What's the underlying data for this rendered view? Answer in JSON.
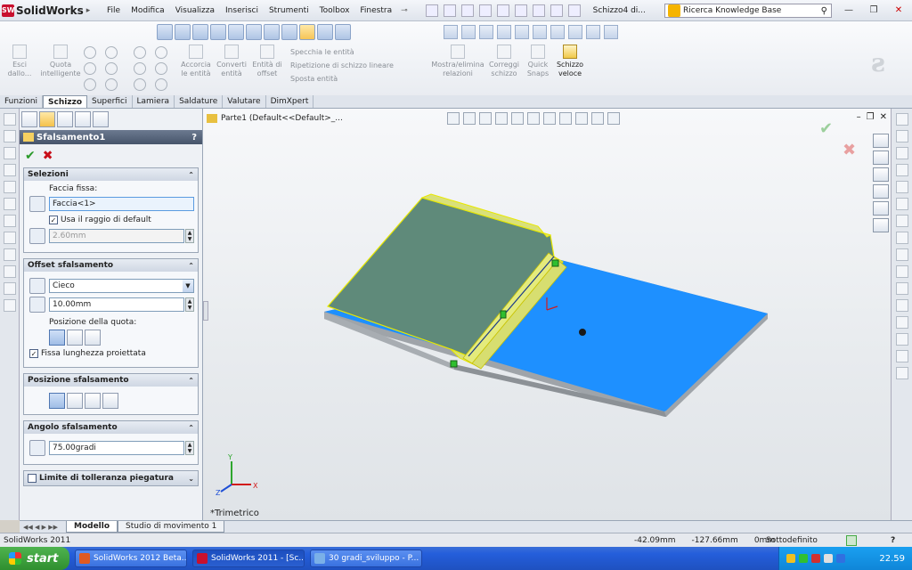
{
  "app": {
    "logo_text": "SolidWorks",
    "menu": [
      "File",
      "Modifica",
      "Visualizza",
      "Inserisci",
      "Strumenti",
      "Toolbox",
      "Finestra"
    ],
    "doc_title": "Schizzo4 di...",
    "search_placeholder": "Ricerca Knowledge Base"
  },
  "ribbon": {
    "groups": [
      {
        "label": "Esci\ndallo...",
        "active": false
      },
      {
        "label": "Quota\nintelligente",
        "active": false
      },
      {
        "label": "Accorcia\nle entità",
        "active": false
      },
      {
        "label": "Converti\nentità",
        "active": false
      },
      {
        "label": "Entità di\noffset",
        "active": false
      },
      {
        "label": "Mostra/elimina\nrelazioni",
        "active": false
      },
      {
        "label": "Correggi\nschizzo",
        "active": false
      },
      {
        "label": "Quick\nSnaps",
        "active": false
      },
      {
        "label": "Schizzo\nveloce",
        "active": true
      }
    ],
    "list_items": [
      "Specchia le entità",
      "Ripetizione di schizzo lineare",
      "Sposta entità"
    ]
  },
  "tabs": [
    {
      "label": "Funzioni",
      "active": false
    },
    {
      "label": "Schizzo",
      "active": true
    },
    {
      "label": "Superfici",
      "active": false
    },
    {
      "label": "Lamiera",
      "active": false
    },
    {
      "label": "Saldature",
      "active": false
    },
    {
      "label": "Valutare",
      "active": false
    },
    {
      "label": "DimXpert",
      "active": false
    }
  ],
  "pm": {
    "title": "Sfalsamento1",
    "help": "?",
    "selezioni": {
      "header": "Selezioni",
      "fixed_face_label": "Faccia fissa:",
      "fixed_face_value": "Faccia<1>",
      "default_radius_label": "Usa il raggio di default",
      "default_radius_checked": true,
      "radius_value": "2.60mm"
    },
    "offset": {
      "header": "Offset sfalsamento",
      "end_condition": "Cieco",
      "distance": "10.00mm",
      "dim_position_label": "Posizione della quota:",
      "fix_length_label": "Fissa lunghezza proiettata",
      "fix_length_checked": true
    },
    "posizione": {
      "header": "Posizione sfalsamento"
    },
    "angolo": {
      "header": "Angolo sfalsamento",
      "value": "75.00gradi"
    },
    "limite": {
      "header": "Limite di tolleranza piegatura",
      "checked": false
    }
  },
  "graphics": {
    "tree_item": "Parte1  (Default<<Default>_...",
    "view_name": "*Trimetrico",
    "axis_labels": {
      "x": "X",
      "y": "Y",
      "z": "Z"
    },
    "colors": {
      "plate": "#1e90ff",
      "flange_fill": "#5f8a7a",
      "selection": "#e8e800",
      "edge": "#2b2b2b"
    }
  },
  "model_tabs": [
    {
      "label": "Modello",
      "active": true
    },
    {
      "label": "Studio di movimento 1",
      "active": false
    }
  ],
  "status": {
    "left": "SolidWorks 2011",
    "x": "-42.09mm",
    "y": "-127.66mm",
    "z": "0mm",
    "state": "Sottodefinito",
    "help": "?"
  },
  "taskbar": {
    "start": "start",
    "items": [
      {
        "label": "SolidWorks 2012 Beta...",
        "active": false
      },
      {
        "label": "SolidWorks 2011 - [Sc...",
        "active": true
      },
      {
        "label": "30 gradi_sviluppo - P...",
        "active": false
      }
    ],
    "clock": "22.59"
  }
}
